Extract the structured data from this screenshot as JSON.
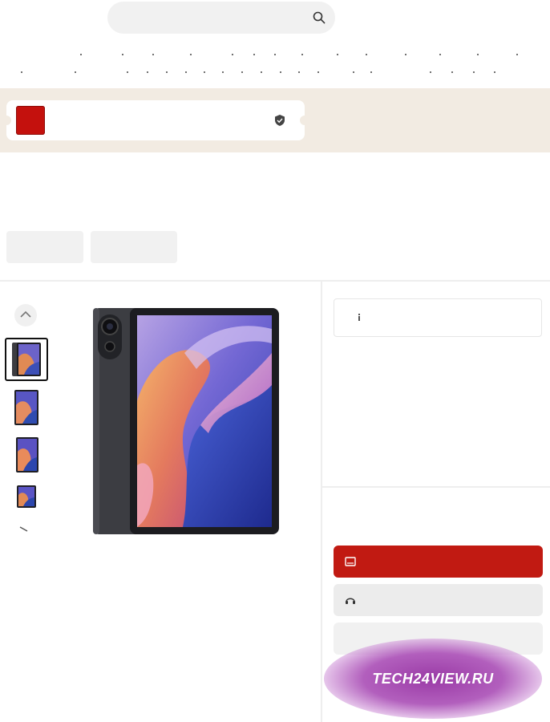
{
  "search": {
    "placeholder": "",
    "icon": "search-icon"
  },
  "promo": {
    "accent_color": "#c4110d",
    "band_color": "#f2ebe2",
    "icon": "shield-icon"
  },
  "gallery": {
    "thumbnail_count": 4,
    "selected_index": 0,
    "icons": {
      "previous": "chevron-up-icon",
      "more": "chevron-down-icon"
    }
  },
  "product_options": {
    "icon": "info-icon"
  },
  "actions": {
    "buy_color": "#c11a12",
    "buy_icon": "cart-icon",
    "consult_icon": "chat-icon"
  },
  "watermark": {
    "text": "TECH24VIEW.RU"
  }
}
